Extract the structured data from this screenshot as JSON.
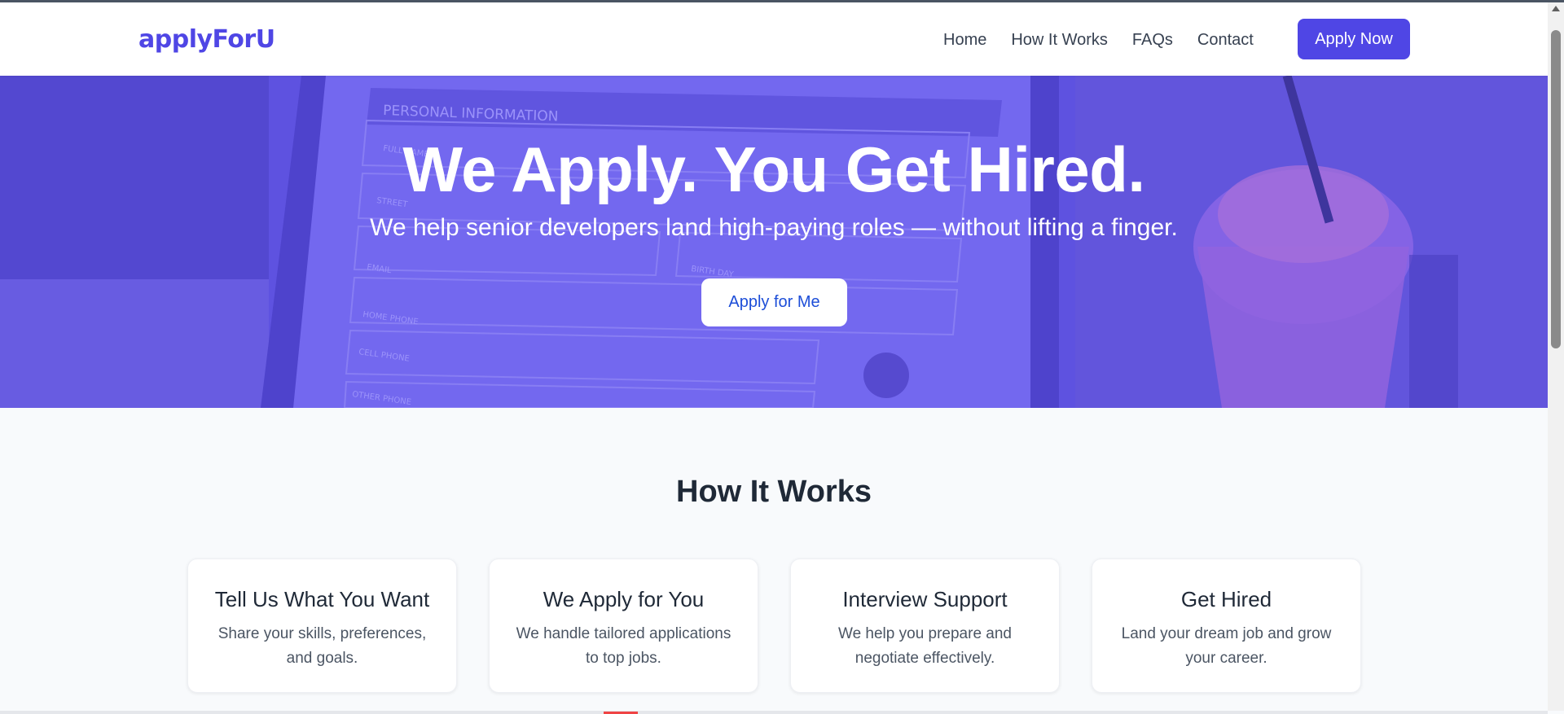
{
  "brand": {
    "logo_text": "applyForU",
    "accent_color": "#4f46e5"
  },
  "nav": {
    "links": [
      {
        "label": "Home"
      },
      {
        "label": "How It Works"
      },
      {
        "label": "FAQs"
      },
      {
        "label": "Contact"
      }
    ],
    "cta_label": "Apply Now"
  },
  "hero": {
    "title": "We Apply. You Get Hired.",
    "subtitle": "We help senior developers land high-paying roles — without lifting a finger.",
    "cta_label": "Apply for Me",
    "background_image_icon": "job-application-photo",
    "form_texts": [
      "PERSONAL INFORMATION",
      "FULL NAME",
      "STREET",
      "EMAIL",
      "BIRTH DAY",
      "HOME PHONE",
      "CELL PHONE",
      "OTHER PHONE"
    ]
  },
  "how_it_works": {
    "title": "How It Works",
    "cards": [
      {
        "title": "Tell Us What You Want",
        "desc": "Share your skills, preferences, and goals."
      },
      {
        "title": "We Apply for You",
        "desc": "We handle tailored applications to top jobs."
      },
      {
        "title": "Interview Support",
        "desc": "We help you prepare and negotiate effectively."
      },
      {
        "title": "Get Hired",
        "desc": "Land your dream job and grow your career."
      }
    ]
  }
}
